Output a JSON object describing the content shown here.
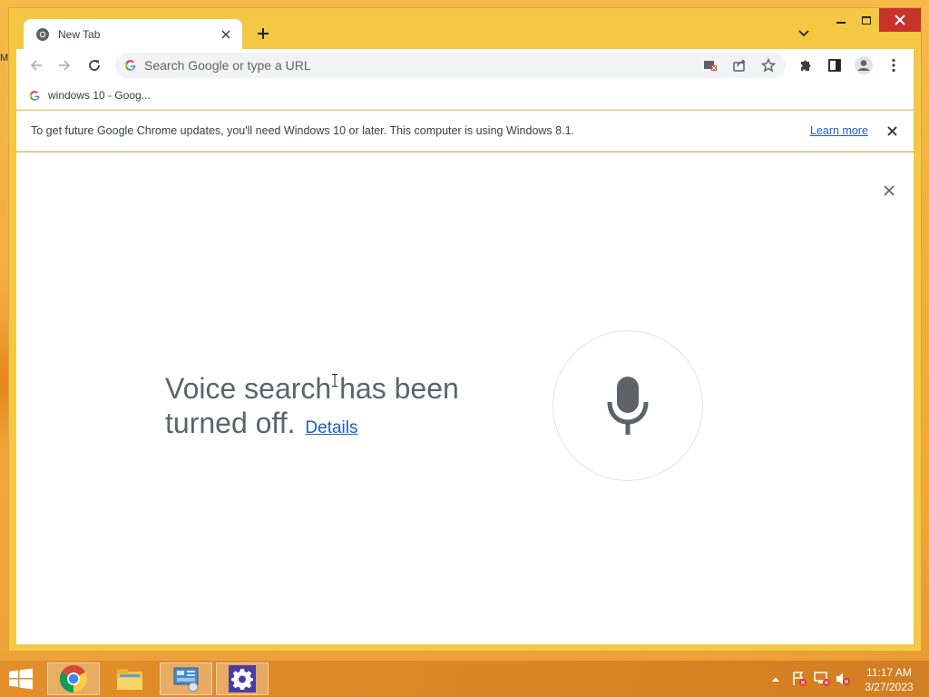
{
  "desktop": {
    "stray_text": "M"
  },
  "window": {
    "tab": {
      "title": "New Tab"
    },
    "caption": {
      "minimize": "minimize",
      "maximize": "maximize",
      "close": "close"
    }
  },
  "toolbar": {
    "omnibox_placeholder": "Search Google or type a URL"
  },
  "bookmarks": [
    {
      "label": "windows 10 - Goog..."
    }
  ],
  "infobar": {
    "message": "To get future Google Chrome updates, you'll need Windows 10 or later. This computer is using Windows 8.1.",
    "link": "Learn more"
  },
  "voice_search": {
    "message": "Voice search has been turned off.",
    "details_link": "Details"
  },
  "taskbar": {
    "apps": [
      "chrome-icon",
      "file-explorer-icon",
      "control-panel-icon",
      "settings-gear-icon"
    ],
    "clock": {
      "time": "11:17 AM",
      "date": "3/27/2023"
    }
  },
  "colors": {
    "accent_link": "#1f5fbf",
    "close_button": "#c7332b",
    "window_frame": "#f5c844",
    "taskbar": "#d88428"
  }
}
